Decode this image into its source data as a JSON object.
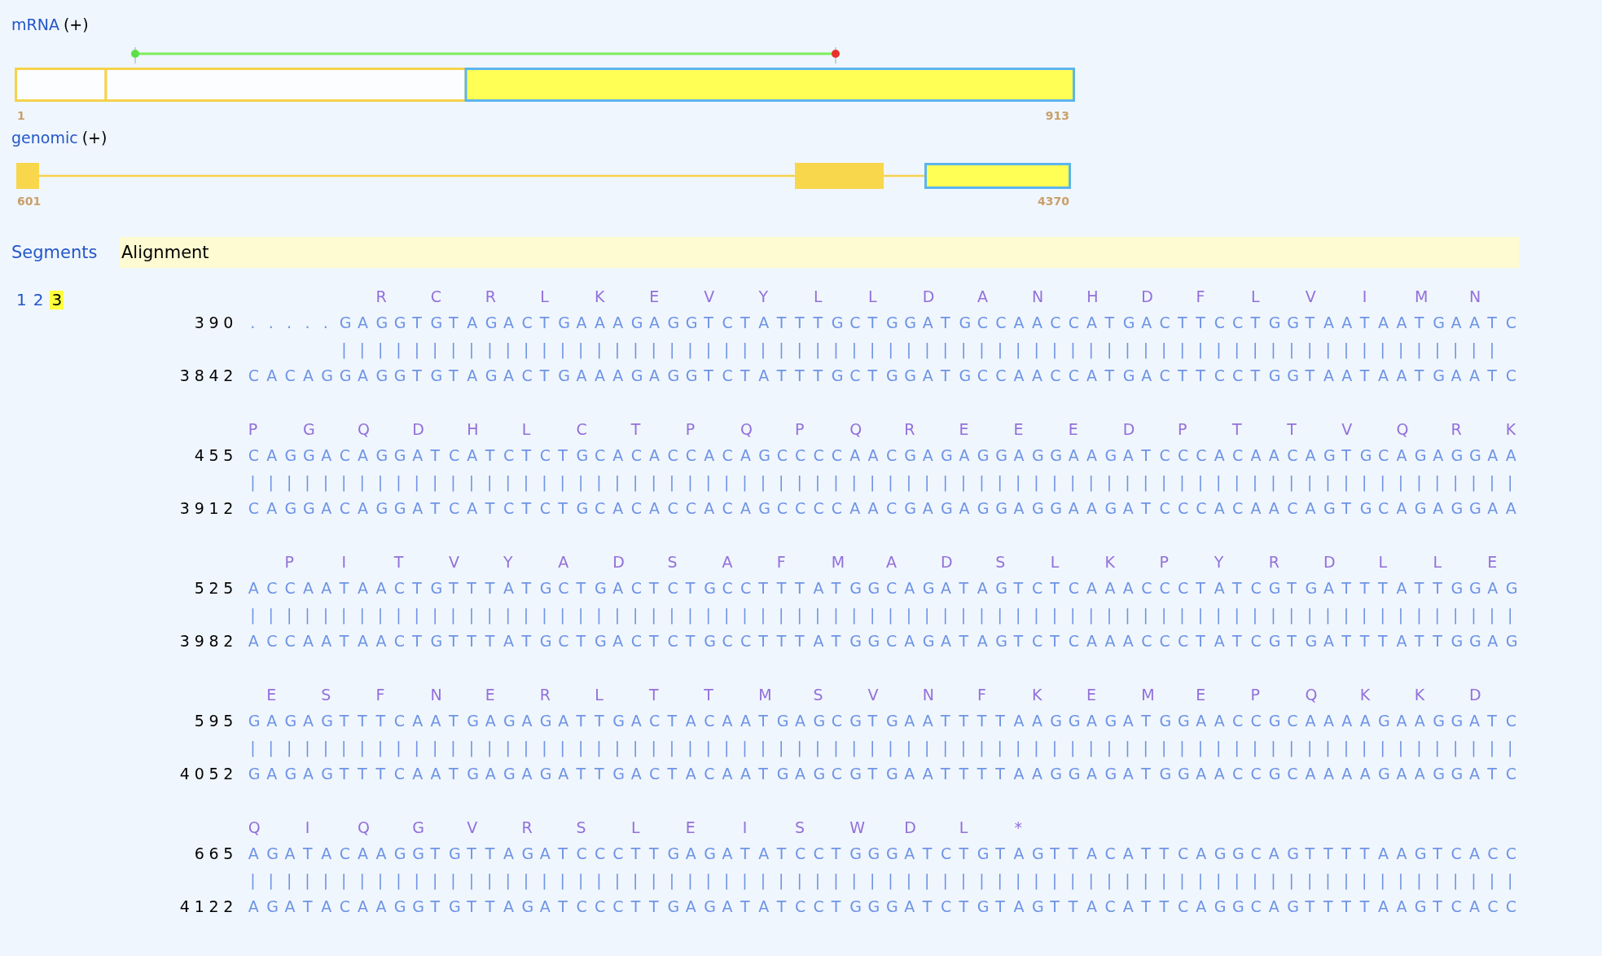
{
  "tracks": [
    {
      "kind": "mrna",
      "name": "mRNA",
      "strand": "(+)",
      "start": "1",
      "end": "913"
    },
    {
      "kind": "genomic",
      "name": "genomic",
      "strand": "(+)",
      "start": "601",
      "end": "4370"
    }
  ],
  "segments_panel": {
    "title": "Segments",
    "items": [
      {
        "label": "1",
        "selected": false
      },
      {
        "label": "2",
        "selected": false
      },
      {
        "label": "3",
        "selected": true
      }
    ]
  },
  "alignment_panel": {
    "title": "Alignment",
    "blocks": [
      {
        "translation": "              R     C     R     L     K     E     V     Y     L     L     D     A     N     H     D     F     L     V     I     M     N",
        "query_start": "390",
        "query": ". . . . . G A G G T G T A G A C T G A A A G A G G T C T A T T T G C T G G A T G C C A A C C A T G A C T T C C T G G T A A T A A T G A A T C",
        "match": "          | | | | | | | | | | | | | | | | | | | | | | | | | | | | | | | | | | | | | | | | | | | | | | | | | | | | | | | | | | | | | | | |",
        "subject_start": "3842",
        "subject": "C A C A G G A G G T G T A G A C T G A A A G A G G T C T A T T T G C T G G A T G C C A A C C A T G A C T T C C T G G T A A T A A T G A A T C"
      },
      {
        "translation": "P     G     Q     D     H     L     C     T     P     Q     P     Q     R     E     E     E     D     P     T     T     V     Q     R     K",
        "query_start": "455",
        "query": "C A G G A C A G G A T C A T C T C T G C A C A C C A C A G C C C C A A C G A G A G G A G G A A G A T C C C A C A A C A G T G C A G A G G A A",
        "match": "| | | | | | | | | | | | | | | | | | | | | | | | | | | | | | | | | | | | | | | | | | | | | | | | | | | | | | | | | | | | | | | | | | | | | |",
        "subject_start": "3912",
        "subject": "C A G G A C A G G A T C A T C T C T G C A C A C C A C A G C C C C A A C G A G A G G A G G A A G A T C C C A C A A C A G T G C A G A G G A A"
      },
      {
        "translation": "    P     I     T     V     Y     A     D     S     A     F     M     A     D     S     L     K     P     Y     R     D     L     L     E",
        "query_start": "525",
        "query": "A C C A A T A A C T G T T T A T G C T G A C T C T G C C T T T A T G G C A G A T A G T C T C A A A C C C T A T C G T G A T T T A T T G G A G",
        "match": "| | | | | | | | | | | | | | | | | | | | | | | | | | | | | | | | | | | | | | | | | | | | | | | | | | | | | | | | | | | | | | | | | | | | | |",
        "subject_start": "3982",
        "subject": "A C C A A T A A C T G T T T A T G C T G A C T C T G C C T T T A T G G C A G A T A G T C T C A A A C C C T A T C G T G A T T T A T T G G A G"
      },
      {
        "translation": "  E     S     F     N     E     R     L     T     T     M     S     V     N     F     K     E     M     E     P     Q     K     K     D",
        "query_start": "595",
        "query": "G A G A G T T T C A A T G A G A G A T T G A C T A C A A T G A G C G T G A A T T T T A A G G A G A T G G A A C C G C A A A A G A A G G A T C",
        "match": "| | | | | | | | | | | | | | | | | | | | | | | | | | | | | | | | | | | | | | | | | | | | | | | | | | | | | | | | | | | | | | | | | | | | | |",
        "subject_start": "4052",
        "subject": "G A G A G T T T C A A T G A G A G A T T G A C T A C A A T G A G C G T G A A T T T T A A G G A G A T G G A A C C G C A A A A G A A G G A T C"
      },
      {
        "translation": "Q     I     Q     G     V     R     S     L     E     I     S     W     D     L     *",
        "query_start": "665",
        "query": "A G A T A C A A G G T G T T A G A T C C C T T G A G A T A T C C T G G G A T C T G T A G T T A C A T T C A G G C A G T T T T A A G T C A C C",
        "match": "| | | | | | | | | | | | | | | | | | | | | | | | | | | | | | | | | | | | | | | | | | | | | | | | | | | | | | | | | | | | | | | | | | | | | |",
        "subject_start": "4122",
        "subject": "A G A T A C A A G G T G T T A G A T C C C T T G A G A T A T C C T G G G A T C T G T A G T T A C A T T C A G G C A G T T T T A A G T C A C C"
      }
    ]
  }
}
